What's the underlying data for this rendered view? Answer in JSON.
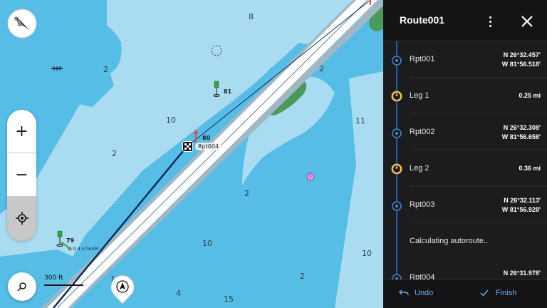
{
  "map": {
    "depths": [
      "8",
      "2",
      "10",
      "2",
      "2",
      "11",
      "2",
      "10",
      "10",
      "2",
      "4",
      "15",
      "1"
    ],
    "buoys": [
      {
        "label": "81"
      },
      {
        "label": "80"
      },
      {
        "label": "79"
      }
    ],
    "light_label": "Q G 4.57m4M",
    "route_point_label": "Rpt004",
    "scale_label": "300 ft",
    "controls": {
      "zoom_in": "+",
      "zoom_out": "−"
    }
  },
  "panel": {
    "title": "Route001",
    "items": [
      {
        "type": "point",
        "name": "Rpt001",
        "lat": "N 26°32.457'",
        "lon": "W 81°56.518'"
      },
      {
        "type": "leg",
        "name": "Leg 1",
        "distance": "0.25 mi"
      },
      {
        "type": "point",
        "name": "Rpt002",
        "lat": "N 26°32.308'",
        "lon": "W 81°56.658'"
      },
      {
        "type": "leg",
        "name": "Leg 2",
        "distance": "0.36 mi"
      },
      {
        "type": "point",
        "name": "Rpt003",
        "lat": "N 26°32.113'",
        "lon": "W 81°56.928'"
      },
      {
        "type": "status",
        "text": "Calculating autoroute.."
      },
      {
        "type": "point",
        "name": "Rpt004",
        "lat": "N 26°31.978'",
        "lon": ""
      }
    ],
    "footer": {
      "undo": "Undo",
      "finish": "Finish"
    }
  },
  "colors": {
    "water_shallow": "#56bde6",
    "water_deep": "#a9dcf1",
    "land": "#4a9a5c",
    "panel_bg": "#1c1c1e",
    "accent_blue": "#1b5fae",
    "leg_marker": "#f2c14e",
    "footer_text": "#6aaef0"
  }
}
